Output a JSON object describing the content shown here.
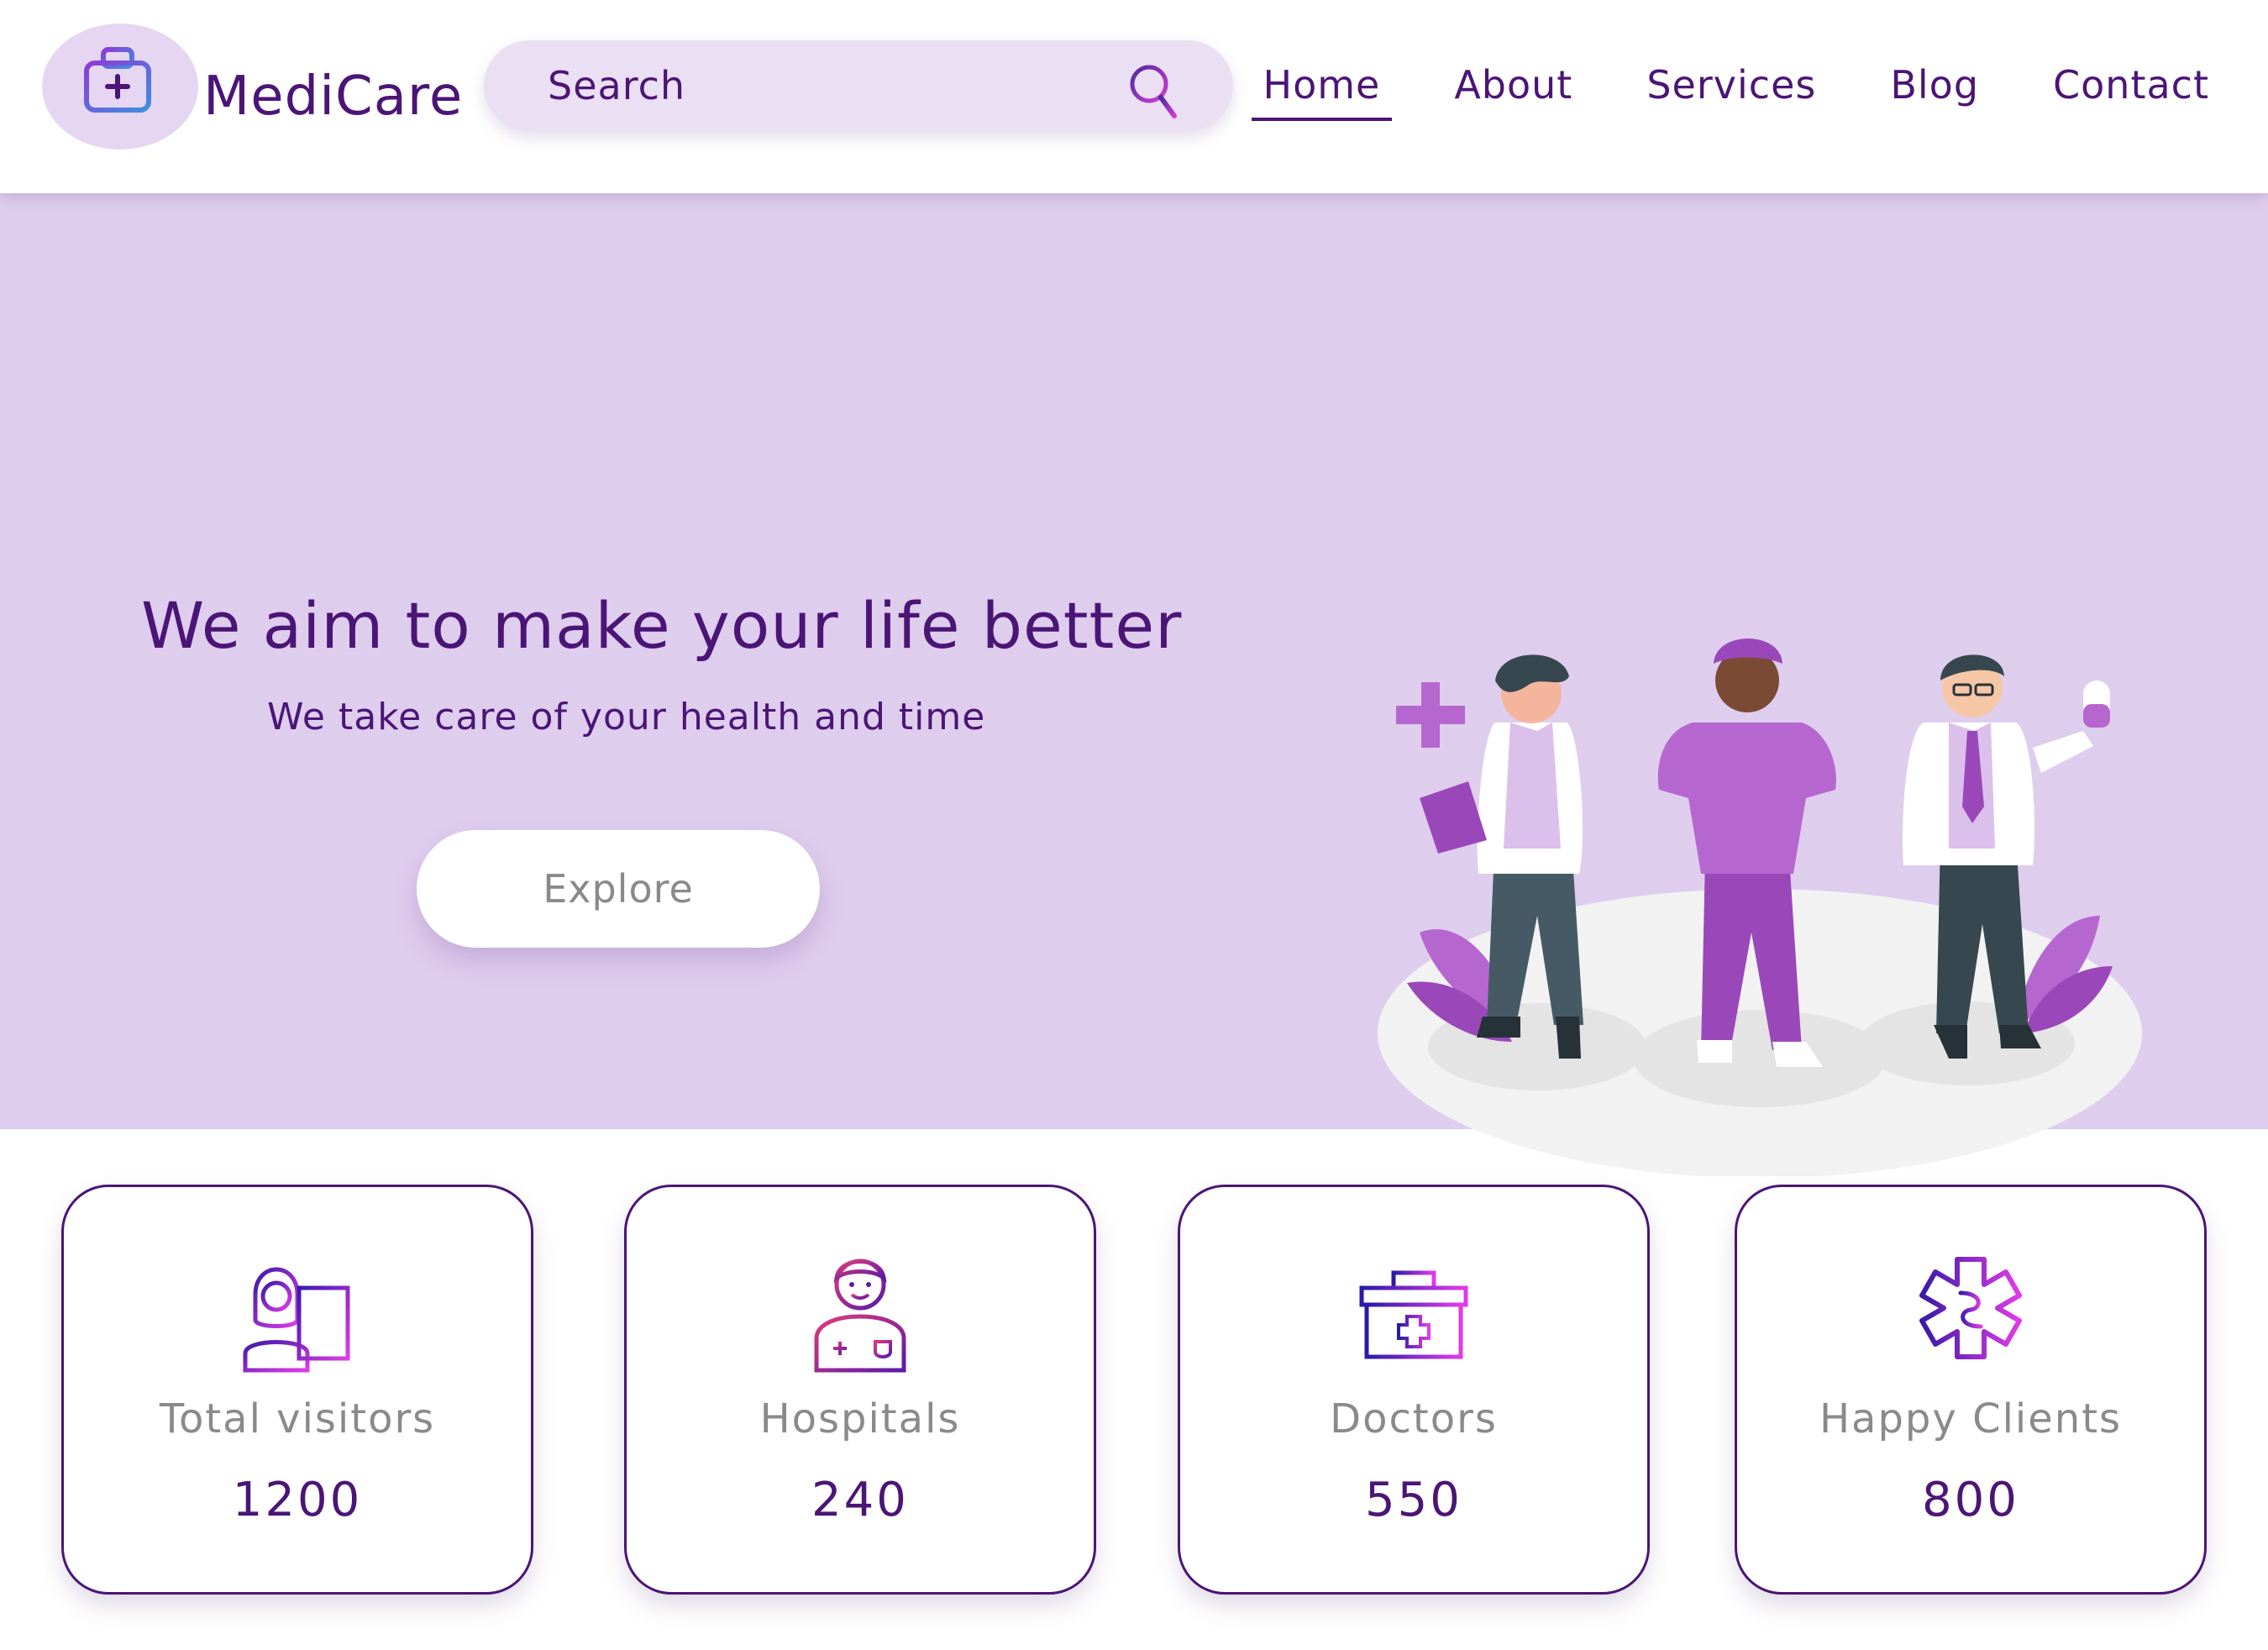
{
  "brand": {
    "name": "MediCare",
    "logo_icon": "medical-kit-icon"
  },
  "search": {
    "placeholder": "Search",
    "icon": "search-icon"
  },
  "nav": {
    "items": [
      {
        "label": "Home",
        "active": true
      },
      {
        "label": "About",
        "active": false
      },
      {
        "label": "Services",
        "active": false
      },
      {
        "label": "Blog",
        "active": false
      },
      {
        "label": "Contact",
        "active": false
      }
    ]
  },
  "hero": {
    "title": "We aim to make your life better",
    "subtitle": "We take care of your health and time",
    "cta_label": "Explore"
  },
  "stats": [
    {
      "label": "Total visitors",
      "value": "1200",
      "icon": "visitor-laptop-icon"
    },
    {
      "label": "Hospitals",
      "value": "240",
      "icon": "doctor-avatar-icon"
    },
    {
      "label": "Doctors",
      "value": "550",
      "icon": "medical-briefcase-icon"
    },
    {
      "label": "Happy Clients",
      "value": "800",
      "icon": "star-of-life-icon"
    }
  ],
  "colors": {
    "primary": "#4b1576",
    "hero_bg": "#dfcdee",
    "search_bg": "#ebdff3",
    "muted_text": "#8a8a8a",
    "accent_magenta": "#e03be8",
    "accent_purple": "#b667cf"
  }
}
